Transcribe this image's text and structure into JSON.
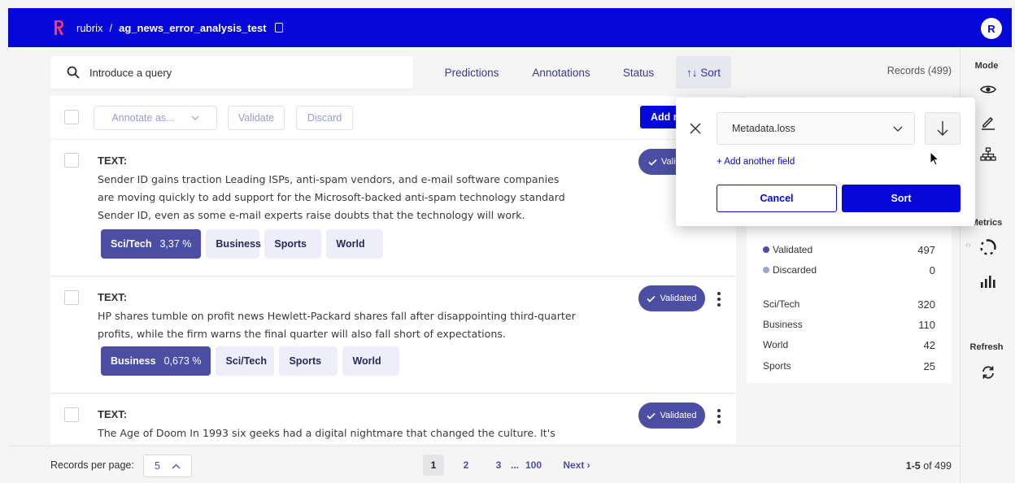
{
  "header": {
    "brand": "rubrix",
    "separator": "/",
    "dataset": "ag_news_error_analysis_test",
    "avatar_initial": "R",
    "brand_color": "#0508d9"
  },
  "filters": {
    "search_placeholder": "Introduce a query",
    "predictions": "Predictions",
    "annotations": "Annotations",
    "status": "Status",
    "sort": "↑↓ Sort",
    "records_count": "Records (499)"
  },
  "toolbar": {
    "annotate_as": "Annotate as...",
    "validate": "Validate",
    "discard": "Discard",
    "add_new": "Add n"
  },
  "records": [
    {
      "title": "TEXT:",
      "text": "Sender ID gains traction Leading ISPs, anti-spam vendors, and e-mail software companies are moving quickly to add support for the Microsoft-backed anti-spam technology standard Sender ID, even as some e-mail experts raise doubts that the technology will work.",
      "status": "Vali",
      "labels": [
        {
          "name": "Sci/Tech",
          "score": "3,37 %",
          "selected": true
        },
        {
          "name": "Business",
          "score": "",
          "selected": false
        },
        {
          "name": "Sports",
          "score": "",
          "selected": false
        },
        {
          "name": "World",
          "score": "",
          "selected": false
        }
      ]
    },
    {
      "title": "TEXT:",
      "text": "HP shares tumble on profit news Hewlett-Packard shares fall after disappointing third-quarter profits, while the firm warns the final quarter will also fall short of expectations.",
      "status": "Validated",
      "labels": [
        {
          "name": "Business",
          "score": "0,673 %",
          "selected": true
        },
        {
          "name": "Sci/Tech",
          "score": "",
          "selected": false
        },
        {
          "name": "Sports",
          "score": "",
          "selected": false
        },
        {
          "name": "World",
          "score": "",
          "selected": false
        }
      ]
    },
    {
      "title": "TEXT:",
      "text": "The Age of Doom In 1993 six geeks had a digital nightmare that changed the culture. It's about",
      "status": "Validated",
      "labels": []
    }
  ],
  "stats": {
    "status_rows": [
      {
        "label": "Validated",
        "value": "497",
        "color": "#4c4ea3"
      },
      {
        "label": "Discarded",
        "value": "0",
        "color": "#a3a4cf"
      }
    ],
    "label_rows": [
      {
        "label": "Sci/Tech",
        "value": "320"
      },
      {
        "label": "Business",
        "value": "110"
      },
      {
        "label": "World",
        "value": "42"
      },
      {
        "label": "Sports",
        "value": "25"
      }
    ]
  },
  "sidebar": {
    "mode": "Mode",
    "metrics": "Metrics",
    "refresh": "Refresh"
  },
  "sort_popup": {
    "field": "Metadata.loss",
    "add_field": "+ Add another field",
    "cancel": "Cancel",
    "sort": "Sort"
  },
  "footer": {
    "records_per_page": "Records per page:",
    "per_page_value": "5",
    "pages": [
      "1",
      "2",
      "3",
      "...",
      "100"
    ],
    "next": "Next ›",
    "range": "1-5",
    "range_of": " of 499"
  }
}
